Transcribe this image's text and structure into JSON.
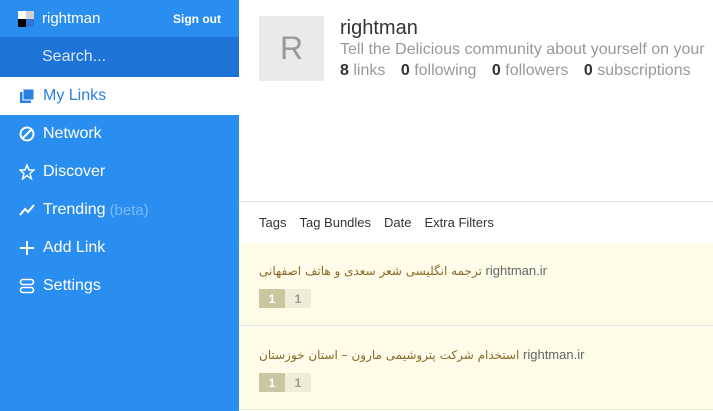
{
  "user": {
    "name": "rightman",
    "signout_label": "Sign out",
    "avatar_letter": "R"
  },
  "search": {
    "placeholder": "Search..."
  },
  "nav": [
    {
      "label": "My Links",
      "icon": "my-links-icon",
      "active": true
    },
    {
      "label": "Network",
      "icon": "network-icon"
    },
    {
      "label": "Discover",
      "icon": "star-icon"
    },
    {
      "label": "Trending",
      "icon": "trending-icon",
      "badge": "(beta)"
    },
    {
      "label": "Add Link",
      "icon": "plus-icon"
    },
    {
      "label": "Settings",
      "icon": "settings-icon"
    }
  ],
  "profile": {
    "name": "rightman",
    "bio": "Tell the Delicious community about yourself on your",
    "stats": [
      {
        "count": "8",
        "label": "links"
      },
      {
        "count": "0",
        "label": "following"
      },
      {
        "count": "0",
        "label": "followers"
      },
      {
        "count": "0",
        "label": "subscriptions"
      }
    ]
  },
  "filters": [
    "Tags",
    "Tag Bundles",
    "Date",
    "Extra Filters"
  ],
  "links": [
    {
      "title": "ترجمه انگلیسی شعر سعدی و  هاتف اصفهانی",
      "domain": "rightman.ir",
      "count_a": "1",
      "count_b": "1"
    },
    {
      "title": "استخدام شرکت پتروشیمی مارون – استان خوزستان",
      "domain": "rightman.ir",
      "count_a": "1",
      "count_b": "1"
    }
  ],
  "colors": {
    "sidebar": "#2a8ef0",
    "search_bg": "#1d73d6",
    "link_bg": "#fefce8"
  }
}
